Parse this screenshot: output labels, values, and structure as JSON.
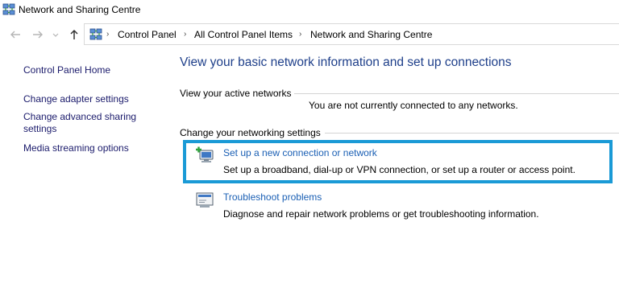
{
  "window": {
    "title": "Network and Sharing Centre"
  },
  "nav": {
    "back": "back-arrow",
    "forward": "forward-arrow",
    "recent": "chevron-down",
    "up": "up-arrow"
  },
  "breadcrumb": [
    "Control Panel",
    "All Control Panel Items",
    "Network and Sharing Centre"
  ],
  "sidebar": {
    "items": [
      {
        "label": "Control Panel Home"
      },
      {
        "label": "Change adapter settings"
      },
      {
        "label": "Change advanced sharing settings"
      },
      {
        "label": "Media streaming options"
      }
    ]
  },
  "main": {
    "title": "View your basic network information and set up connections",
    "active_networks_label": "View your active networks",
    "active_networks_status": "You are not currently connected to any networks.",
    "settings_label": "Change your networking settings",
    "tasks": [
      {
        "link": "Set up a new connection or network",
        "description": "Set up a broadband, dial-up or VPN connection, or set up a router or access point.",
        "icon": "new-connection-icon"
      },
      {
        "link": "Troubleshoot problems",
        "description": "Diagnose and repair network problems or get troubleshooting information.",
        "icon": "troubleshoot-icon"
      }
    ]
  },
  "colors": {
    "link": "#1a5fb4",
    "title": "#1e3f8a",
    "highlight": "#1a9ad6"
  }
}
